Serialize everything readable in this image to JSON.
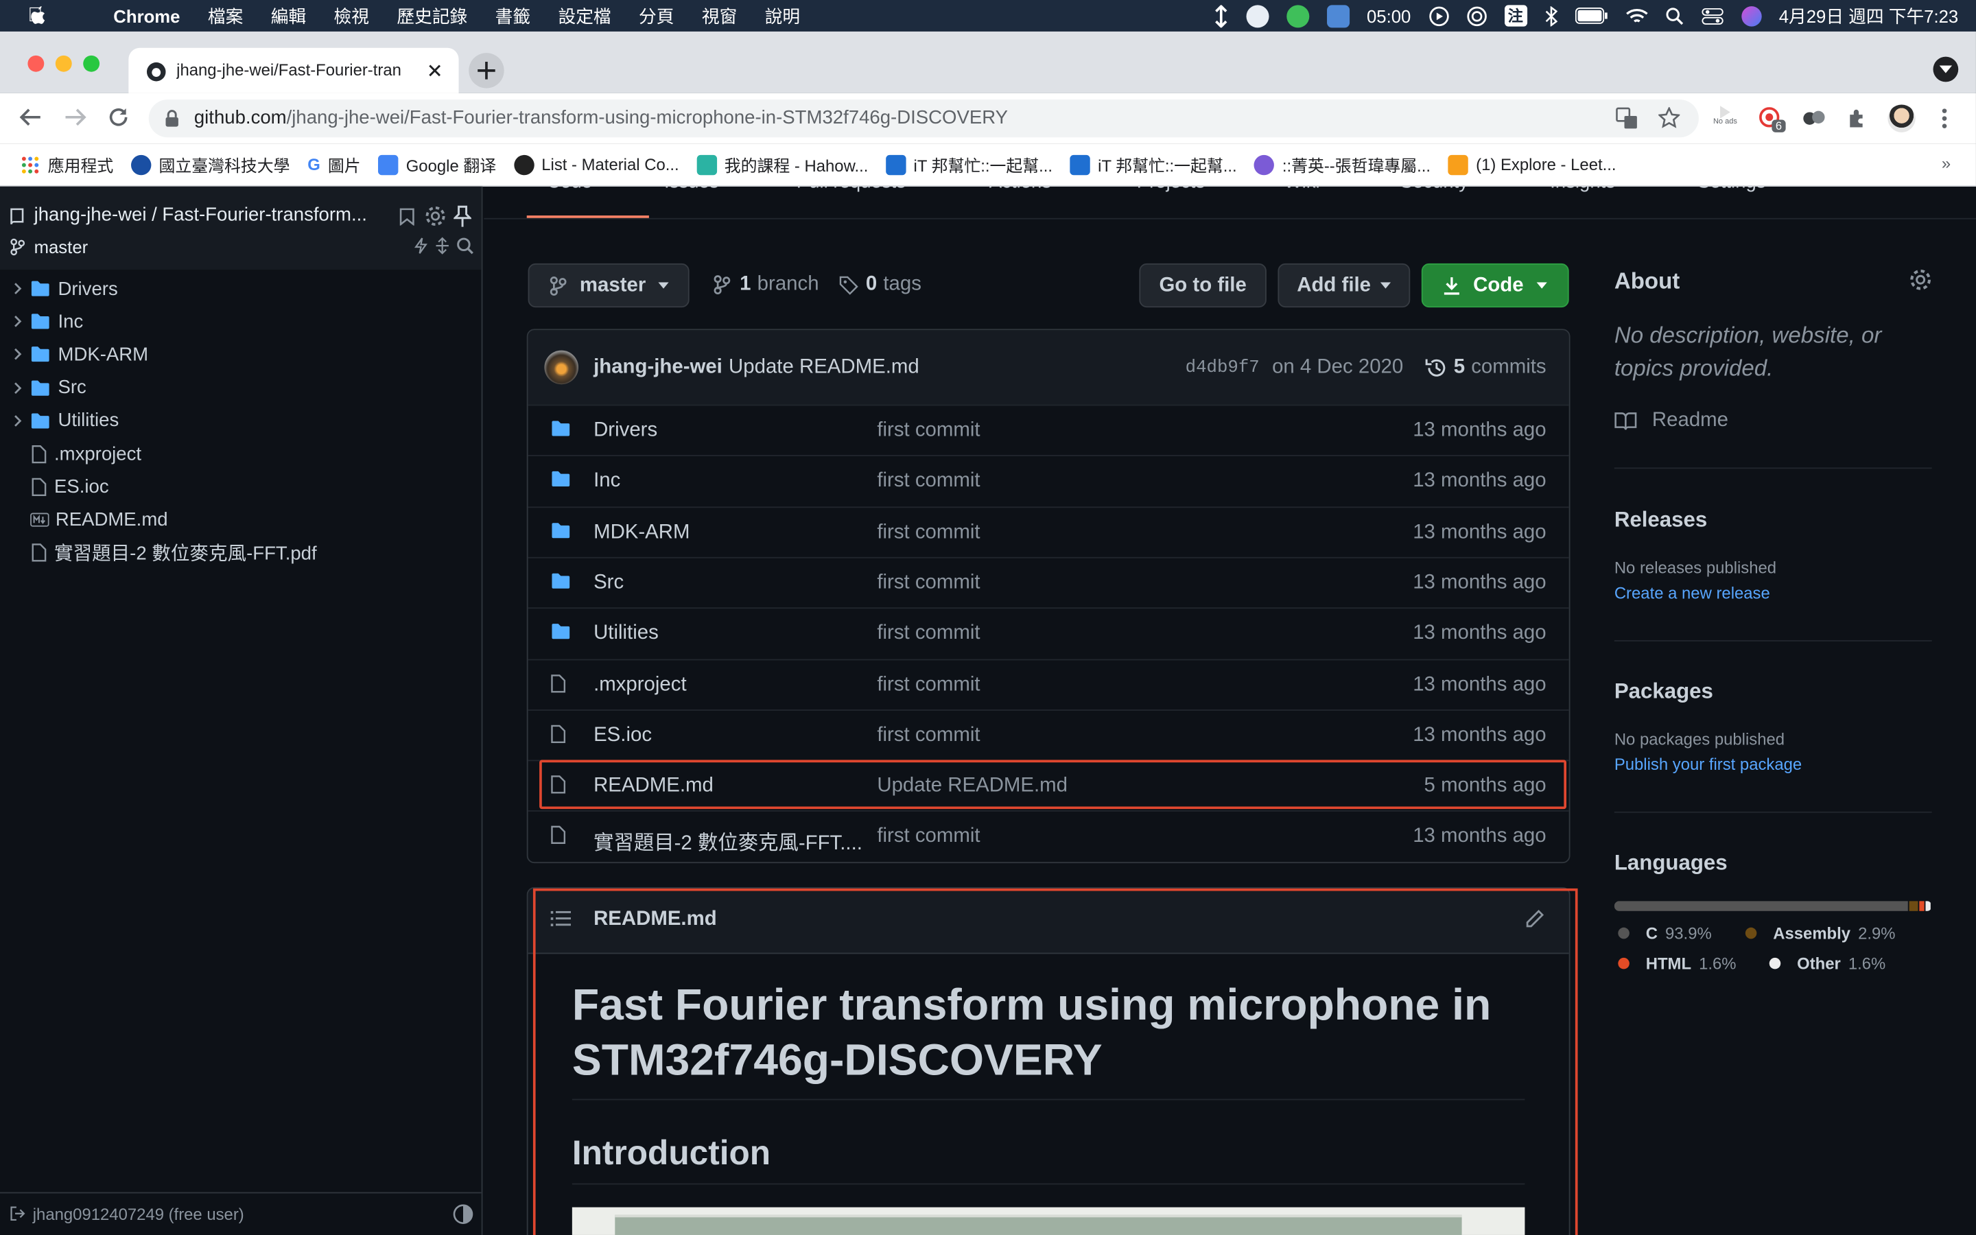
{
  "menubar": {
    "app": "Chrome",
    "items": [
      "檔案",
      "編輯",
      "檢視",
      "歷史記錄",
      "書籤",
      "設定檔",
      "分頁",
      "視窗",
      "說明"
    ],
    "timer": "05:00",
    "ime": "注",
    "datetime": "4月29日 週四 下午7:23"
  },
  "browser": {
    "tab_title": "jhang-jhe-wei/Fast-Fourier-tran",
    "url_domain": "github.com",
    "url_path": "/jhang-jhe-wei/Fast-Fourier-transform-using-microphone-in-STM32f746g-DISCOVERY",
    "ext_noads": "No ads",
    "ext_badge": "6",
    "bookmarks": [
      {
        "label": "應用程式",
        "color": "#ea4335"
      },
      {
        "label": "國立臺灣科技大學",
        "color": "#1a4fa3"
      },
      {
        "label": "圖片",
        "color": "#4285f4"
      },
      {
        "label": "Google 翻译",
        "color": "#4285f4"
      },
      {
        "label": "List - Material Co...",
        "color": "#222222"
      },
      {
        "label": "我的課程 - Hahow...",
        "color": "#2bb3a3"
      },
      {
        "label": "iT 邦幫忙::一起幫...",
        "color": "#1f6fd1"
      },
      {
        "label": "iT 邦幫忙::一起幫...",
        "color": "#1f6fd1"
      },
      {
        "label": "::菁英--張哲瑋專屬...",
        "color": "#7b5bd6"
      },
      {
        "label": "(1) Explore - Leet...",
        "color": "#f89f1b"
      }
    ],
    "bookmarks_more": "»"
  },
  "sidebar": {
    "repo": "jhang-jhe-wei / Fast-Fourier-transform...",
    "branch": "master",
    "tree": [
      {
        "name": "Drivers",
        "type": "folder"
      },
      {
        "name": "Inc",
        "type": "folder"
      },
      {
        "name": "MDK-ARM",
        "type": "folder"
      },
      {
        "name": "Src",
        "type": "folder"
      },
      {
        "name": "Utilities",
        "type": "folder"
      },
      {
        "name": ".mxproject",
        "type": "file"
      },
      {
        "name": "ES.ioc",
        "type": "file"
      },
      {
        "name": "README.md",
        "type": "md"
      },
      {
        "name": "實習題目-2 數位麥克風-FFT.pdf",
        "type": "file"
      }
    ],
    "user": "jhang0912407249 (free user)"
  },
  "repo_nav": {
    "tabs": [
      "Code",
      "Issues",
      "Pull requests",
      "Actions",
      "Projects",
      "Wiki",
      "Security",
      "Insights",
      "Settings"
    ]
  },
  "toolbar": {
    "branch": "master",
    "branch_count": "1",
    "branch_label": "branch",
    "tag_count": "0",
    "tag_label": "tags",
    "go_to_file": "Go to file",
    "add_file": "Add file",
    "code": "Code"
  },
  "commit": {
    "author": "jhang-jhe-wei",
    "message": "Update README.md",
    "sha": "d4db9f7",
    "date": "on 4 Dec 2020",
    "count": "5",
    "count_label": "commits"
  },
  "files": [
    {
      "name": "Drivers",
      "type": "folder",
      "commit": "first commit",
      "age": "13 months ago"
    },
    {
      "name": "Inc",
      "type": "folder",
      "commit": "first commit",
      "age": "13 months ago"
    },
    {
      "name": "MDK-ARM",
      "type": "folder",
      "commit": "first commit",
      "age": "13 months ago"
    },
    {
      "name": "Src",
      "type": "folder",
      "commit": "first commit",
      "age": "13 months ago"
    },
    {
      "name": "Utilities",
      "type": "folder",
      "commit": "first commit",
      "age": "13 months ago"
    },
    {
      "name": ".mxproject",
      "type": "file",
      "commit": "first commit",
      "age": "13 months ago"
    },
    {
      "name": "ES.ioc",
      "type": "file",
      "commit": "first commit",
      "age": "13 months ago"
    },
    {
      "name": "README.md",
      "type": "file",
      "commit": "Update README.md",
      "age": "5 months ago",
      "highlight": true
    },
    {
      "name": "實習題目-2 數位麥克風-FFT....",
      "type": "file",
      "commit": "first commit",
      "age": "13 months ago"
    }
  ],
  "readme": {
    "filename": "README.md",
    "title_line1": "Fast Fourier transform using microphone in",
    "title_line2": "STM32f746g-DISCOVERY",
    "h2": "Introduction"
  },
  "about": {
    "heading": "About",
    "description": "No description, website, or topics provided.",
    "readme": "Readme",
    "releases_heading": "Releases",
    "releases_text": "No releases published",
    "releases_link": "Create a new release",
    "packages_heading": "Packages",
    "packages_text": "No packages published",
    "packages_link": "Publish your first package",
    "languages_heading": "Languages",
    "languages": [
      {
        "name": "C",
        "pct": "93.9%",
        "value": 93.9,
        "color": "#555555"
      },
      {
        "name": "Assembly",
        "pct": "2.9%",
        "value": 2.9,
        "color": "#6e4c13"
      },
      {
        "name": "HTML",
        "pct": "1.6%",
        "value": 1.6,
        "color": "#e34c26"
      },
      {
        "name": "Other",
        "pct": "1.6%",
        "value": 1.6,
        "color": "#ededed"
      }
    ]
  },
  "colors": {
    "highlight_border": "#e0472f",
    "green_button": "#238636",
    "link": "#58a6ff"
  }
}
